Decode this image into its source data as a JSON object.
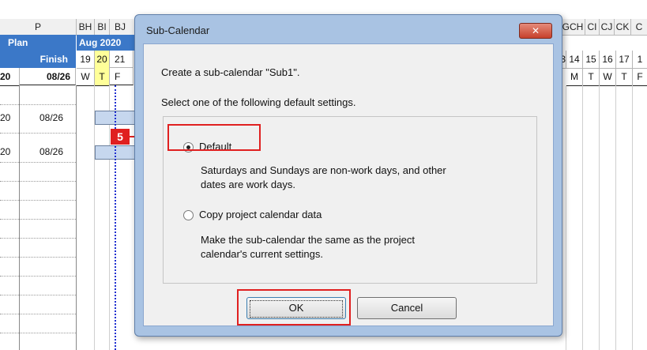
{
  "sheet": {
    "columns": [
      "P",
      "BH",
      "BI",
      "BJ",
      "GCH",
      "CI",
      "CJ",
      "CK",
      "C"
    ],
    "plan_label": "Plan",
    "month_label": "Aug 2020",
    "finish_label": "Finish",
    "dates_left": [
      "19",
      "20",
      "21"
    ],
    "dates_right": [
      "3",
      "14",
      "15",
      "16",
      "17",
      "1"
    ],
    "days_left": [
      "W",
      "T",
      "F"
    ],
    "days_right": [
      "M",
      "T",
      "W",
      "T",
      "F"
    ],
    "header_row": {
      "left": "20",
      "finish": "08/26"
    },
    "rows": [
      {
        "left": "20",
        "finish": "08/26"
      },
      {
        "left": "20",
        "finish": "08/26"
      }
    ]
  },
  "dialog": {
    "title": "Sub-Calendar",
    "close_label": "✕",
    "intro": "Create a sub-calendar \"Sub1\".",
    "prompt": "Select one of the following default settings.",
    "option_default": {
      "label": "Default",
      "description_line1": "Saturdays and Sundays are non-work days, and other",
      "description_line2": "dates are work days."
    },
    "option_copy": {
      "label": "Copy project calendar data",
      "description_line1": "Make the sub-calendar the same as the project",
      "description_line2": "calendar's current settings."
    },
    "ok_label": "OK",
    "cancel_label": "Cancel"
  },
  "annotation": {
    "step_number": "5",
    "highlight_color": "#e02020"
  },
  "colors": {
    "header_blue": "#3b78c8",
    "today_yellow": "#ffff99",
    "dialog_frame": "#a9c3e3"
  }
}
